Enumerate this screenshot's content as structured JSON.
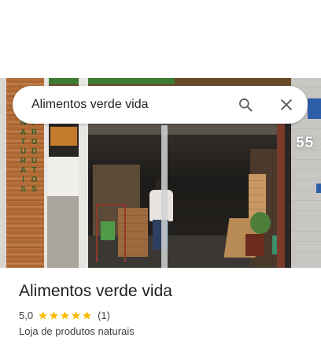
{
  "search": {
    "query": "Alimentos verde vida"
  },
  "photo": {
    "house_number": "55",
    "wood_sign_text": "PRODUTOS NATURAIS"
  },
  "place": {
    "title": "Alimentos verde vida",
    "rating": "5,0",
    "stars": 5,
    "review_count": "(1)",
    "category": "Loja de produtos naturais"
  },
  "colors": {
    "star": "#fbbc04",
    "text_primary": "#202124",
    "text_secondary": "#3c4043",
    "icon": "#5f6368"
  },
  "icons": {
    "search": "search-icon",
    "close": "close-icon",
    "star": "star-icon"
  }
}
